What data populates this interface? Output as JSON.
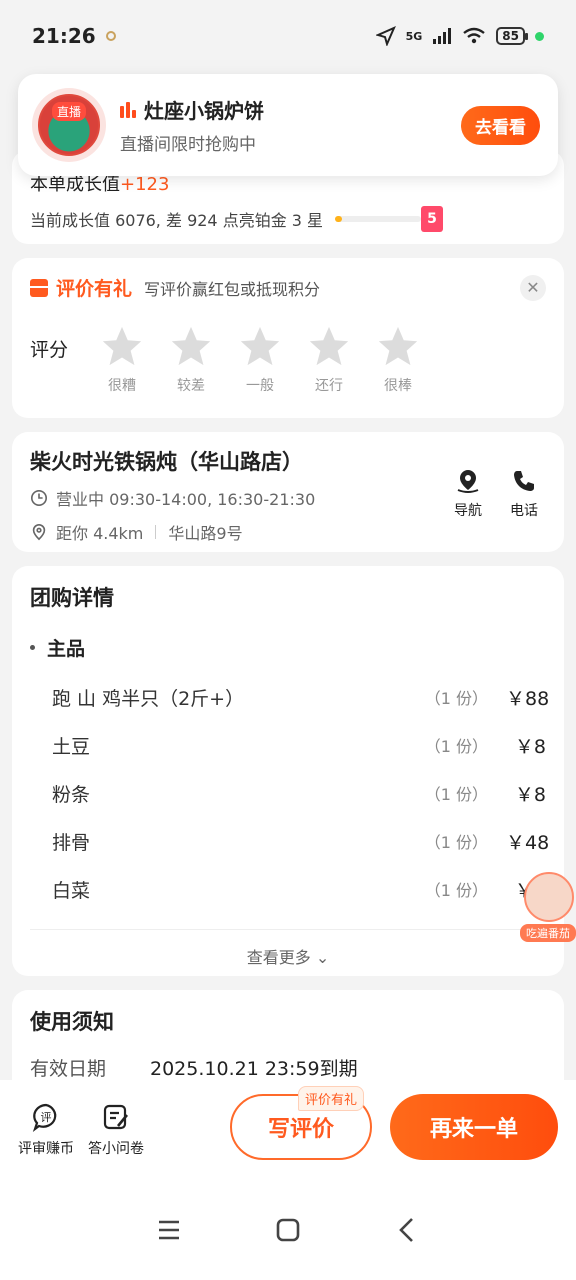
{
  "status": {
    "time": "21:26",
    "network": "5G",
    "battery": "85"
  },
  "live": {
    "badge": "直播",
    "title": "灶座小锅炉饼",
    "subtitle": "直播间限时抢购中",
    "button": "去看看"
  },
  "growth": {
    "line1_prefix": "本单成长值",
    "line1_plus": "+123",
    "line2": "当前成长值 6076, 差 924 点亮铂金 3 星",
    "progress_fraction": 0.08,
    "gift_label": "5"
  },
  "review": {
    "title": "评价有礼",
    "desc": "写评价赢红包或抵现积分",
    "close": "✕",
    "rating_label": "评分",
    "stars": [
      "很糟",
      "较差",
      "一般",
      "还行",
      "很棒"
    ]
  },
  "shop": {
    "name": "柴火时光铁锅炖（华山路店）",
    "hours": "营业中 09:30-14:00, 16:30-21:30",
    "distance": "距你 4.4km",
    "address": "华山路9号",
    "nav_label": "导航",
    "call_label": "电话"
  },
  "deal": {
    "title": "团购详情",
    "group_label": "主品",
    "items": [
      {
        "name": "跑 山 鸡半只（2斤+）",
        "qty": "（1 份）",
        "price": "￥88"
      },
      {
        "name": "土豆",
        "qty": "（1 份）",
        "price": "￥8"
      },
      {
        "name": "粉条",
        "qty": "（1 份）",
        "price": "￥8"
      },
      {
        "name": "排骨",
        "qty": "（1 份）",
        "price": "￥48"
      },
      {
        "name": "白菜",
        "qty": "（1 份）",
        "price": "￥8"
      }
    ],
    "see_more": "查看更多 ⌄"
  },
  "mascot": {
    "label": "吃遍番茄"
  },
  "notice": {
    "title": "使用须知",
    "validity_label": "有效日期",
    "validity_value": "2025.10.21 23:59到期"
  },
  "bottom": {
    "review_earn": "评审赚币",
    "survey": "答小问卷",
    "write_review": "写评价",
    "write_tag": "评价有礼",
    "reorder": "再来一单"
  }
}
